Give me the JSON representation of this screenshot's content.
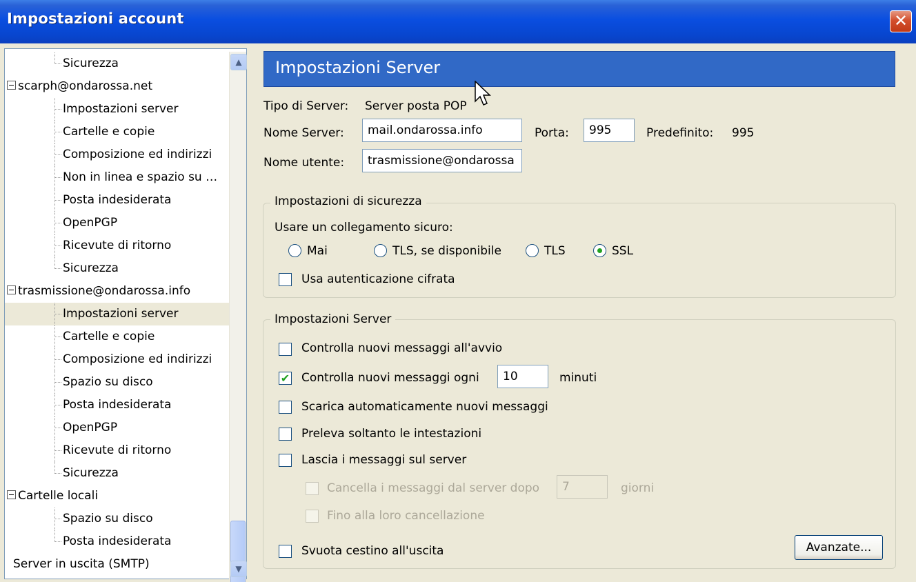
{
  "window": {
    "title": "Impostazioni account",
    "close_glyph": "✕"
  },
  "tree": {
    "items": [
      {
        "label": "Sicurezza",
        "level": 1
      },
      {
        "label": "scarph@ondarossa.net",
        "level": 0
      },
      {
        "label": "Impostazioni server",
        "level": 1
      },
      {
        "label": "Cartelle e copie",
        "level": 1
      },
      {
        "label": "Composizione ed indirizzi",
        "level": 1
      },
      {
        "label": "Non in linea e spazio su …",
        "level": 1
      },
      {
        "label": "Posta indesiderata",
        "level": 1
      },
      {
        "label": "OpenPGP",
        "level": 1
      },
      {
        "label": "Ricevute di ritorno",
        "level": 1
      },
      {
        "label": "Sicurezza",
        "level": 1
      },
      {
        "label": "trasmissione@ondarossa.info",
        "level": 0
      },
      {
        "label": "Impostazioni server",
        "level": 1,
        "selected": true
      },
      {
        "label": "Cartelle e copie",
        "level": 1
      },
      {
        "label": "Composizione ed indirizzi",
        "level": 1
      },
      {
        "label": "Spazio su disco",
        "level": 1
      },
      {
        "label": "Posta indesiderata",
        "level": 1
      },
      {
        "label": "OpenPGP",
        "level": 1
      },
      {
        "label": "Ricevute di ritorno",
        "level": 1
      },
      {
        "label": "Sicurezza",
        "level": 1
      },
      {
        "label": "Cartelle locali",
        "level": 0
      },
      {
        "label": "Spazio su disco",
        "level": 1
      },
      {
        "label": "Posta indesiderata",
        "level": 1
      },
      {
        "label": "Server in uscita (SMTP)",
        "level": 0
      }
    ],
    "scroll_up_glyph": "▲",
    "scroll_down_glyph": "▼"
  },
  "panel": {
    "header": "Impostazioni Server",
    "server_type_label": "Tipo di Server:",
    "server_type_value": "Server posta POP",
    "server_name_label": "Nome Server:",
    "server_name_value": "mail.ondarossa.info",
    "port_label": "Porta:",
    "port_value": "995",
    "default_label": "Predefinito:",
    "default_value": "995",
    "username_label": "Nome utente:",
    "username_value": "trasmissione@ondarossa"
  },
  "security": {
    "group_title": "Impostazioni di sicurezza",
    "secure_label": "Usare un collegamento sicuro:",
    "radios": [
      {
        "label": "Mai",
        "checked": false
      },
      {
        "label": "TLS, se disponibile",
        "checked": false
      },
      {
        "label": "TLS",
        "checked": false
      },
      {
        "label": "SSL",
        "checked": true
      }
    ],
    "encrypted_auth_label": "Usa autenticazione cifrata",
    "encrypted_auth_checked": false
  },
  "server_settings": {
    "group_title": "Impostazioni Server",
    "check_startup_label": "Controlla nuovi messaggi all'avvio",
    "check_every_label": "Controlla nuovi messaggi ogni",
    "check_every_value": "10",
    "minutes_label": "minuti",
    "auto_download_label": "Scarica automaticamente nuovi messaggi",
    "headers_only_label": "Preleva soltanto le intestazioni",
    "leave_on_server_label": "Lascia i messaggi sul server",
    "delete_after_label": "Cancella i messaggi dal server dopo",
    "delete_after_value": "7",
    "days_label": "giorni",
    "until_deleted_label": "Fino alla loro cancellazione",
    "empty_trash_label": "Svuota cestino all'uscita",
    "advanced_button": "Avanzate...",
    "check_mark": "✔"
  }
}
